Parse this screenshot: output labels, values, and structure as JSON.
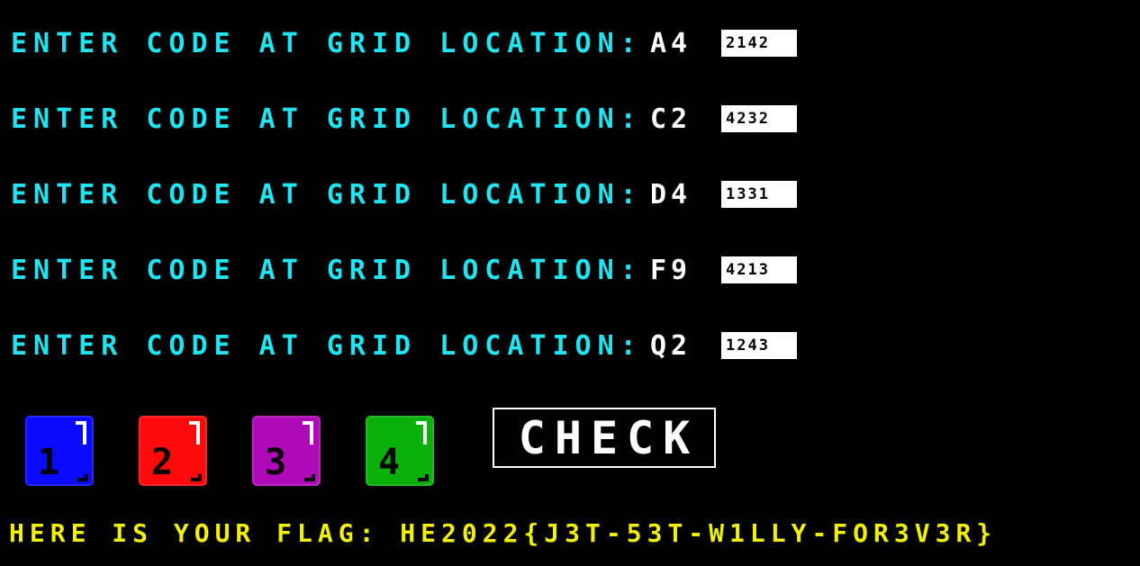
{
  "rows": [
    {
      "prompt": "ENTER CODE AT GRID LOCATION:",
      "location": "A4",
      "code": "2142"
    },
    {
      "prompt": "ENTER CODE AT GRID LOCATION:",
      "location": "C2",
      "code": "4232"
    },
    {
      "prompt": "ENTER CODE AT GRID LOCATION:",
      "location": "D4",
      "code": "1331"
    },
    {
      "prompt": "ENTER CODE AT GRID LOCATION:",
      "location": "F9",
      "code": "4213"
    },
    {
      "prompt": "ENTER CODE AT GRID LOCATION:",
      "location": "Q2",
      "code": "1243"
    }
  ],
  "dice": [
    {
      "label": "1",
      "color": "#0a0aff"
    },
    {
      "label": "2",
      "color": "#ff0a0a"
    },
    {
      "label": "3",
      "color": "#b00ab8"
    },
    {
      "label": "4",
      "color": "#0ab00a"
    }
  ],
  "check_button": {
    "label": "CHECK"
  },
  "flag_text": "HERE IS YOUR FLAG: HE2022{J3T-53T-W1LLY-FOR3V3R}",
  "colors": {
    "prompt": "#22e3f0",
    "location": "#ffffff",
    "flag": "#f0f000",
    "background": "#000000"
  }
}
